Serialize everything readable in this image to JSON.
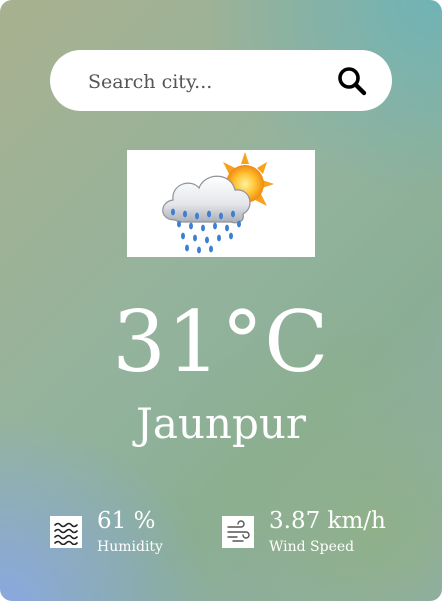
{
  "search": {
    "placeholder": "Search city...",
    "button_icon": "search-icon"
  },
  "weather": {
    "icon": "rain-cloud-sun-icon",
    "temperature": "31°C",
    "city": "Jaunpur"
  },
  "details": {
    "humidity": {
      "icon": "humidity-waves-icon",
      "value": "61 %",
      "label": "Humidity"
    },
    "wind": {
      "icon": "wind-icon",
      "value": "3.87 km/h",
      "label": "Wind Speed"
    }
  }
}
